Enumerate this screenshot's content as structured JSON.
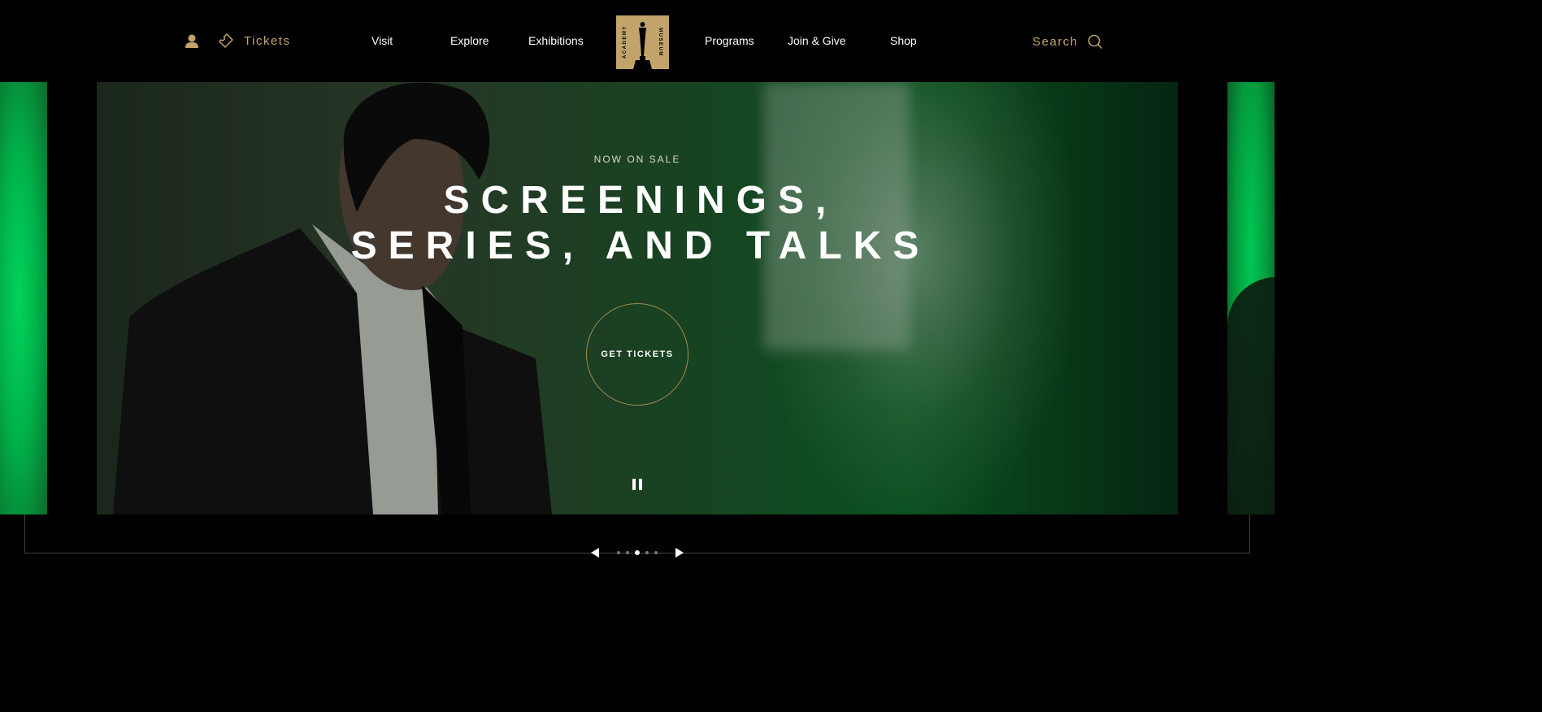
{
  "header": {
    "tickets_label": "Tickets",
    "nav": [
      {
        "label": "Visit"
      },
      {
        "label": "Explore"
      },
      {
        "label": "Exhibitions"
      },
      {
        "label": "Programs"
      },
      {
        "label": "Join & Give"
      },
      {
        "label": "Shop"
      }
    ],
    "logo": {
      "left_text": "ACADEMY",
      "right_text": "MUSEUM"
    },
    "search_label": "Search"
  },
  "hero": {
    "eyebrow": "NOW ON SALE",
    "title_line1": "SCREENINGS,",
    "title_line2": "SERIES, AND TALKS",
    "cta_label": "GET TICKETS"
  },
  "carousel": {
    "slide_count": 5,
    "active_index": 2
  },
  "colors": {
    "accent_gold": "#c3a36b",
    "background": "#000000",
    "hero_green": "#0d6b2a"
  },
  "icons": {
    "user": "user-icon",
    "ticket": "ticket-icon",
    "search": "search-icon",
    "pause": "pause-icon",
    "prev": "arrow-left-icon",
    "next": "arrow-right-icon"
  }
}
